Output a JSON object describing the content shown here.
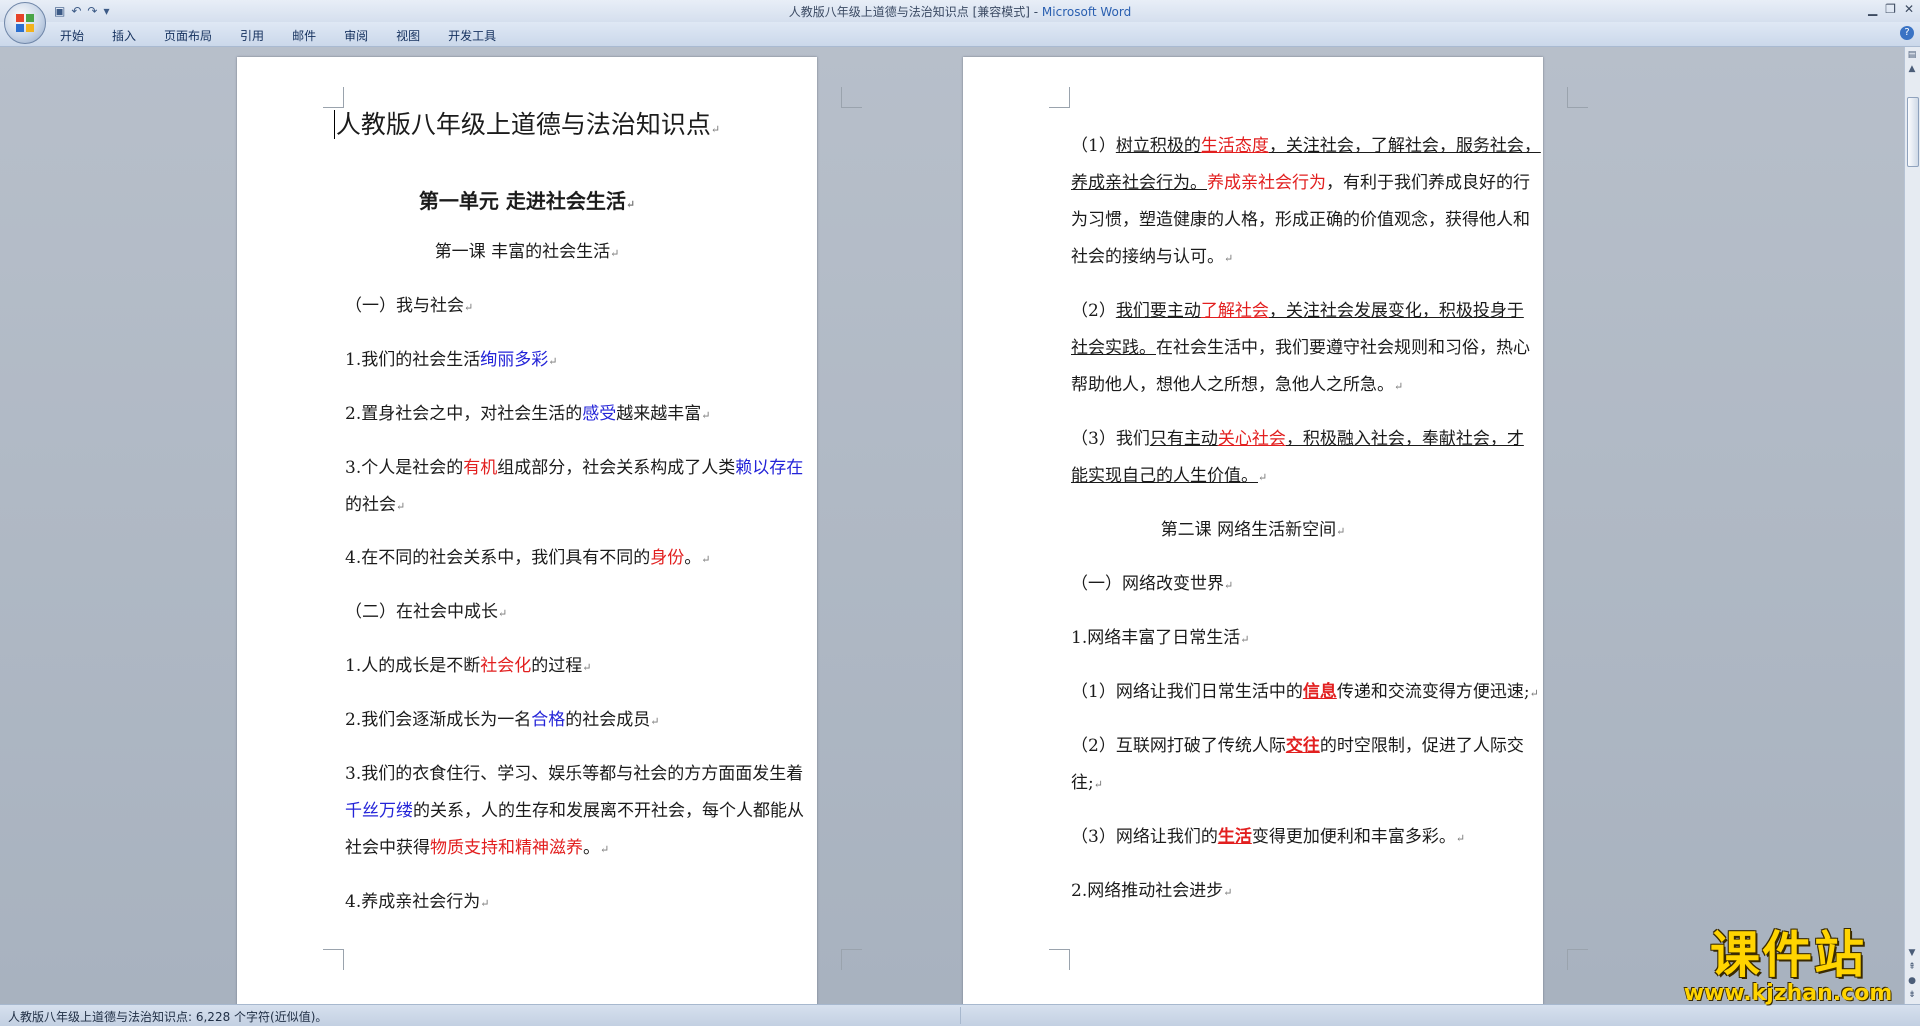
{
  "window": {
    "title": "人教版八年级上道德与法治知识点 [兼容模式] - ",
    "app": "Microsoft Word"
  },
  "ribbon": {
    "tabs": [
      "开始",
      "插入",
      "页面布局",
      "引用",
      "邮件",
      "审阅",
      "视图",
      "开发工具"
    ]
  },
  "left_page": {
    "title": "人教版八年级上道德与法治知识点",
    "unit": "第一单元 走进社会生活",
    "lesson": "第一课 丰富的社会生活",
    "sec1": "（一）我与社会",
    "p1a": "1.我们的社会生活",
    "p1b": "绚丽多彩",
    "p2a": "2.置身社会之中，对社会生活的",
    "p2b": "感受",
    "p2c": "越来越丰富",
    "p3a": "3.个人是社会的",
    "p3b": "有机",
    "p3c": "组成部分，社会关系构成了人类",
    "p3d": "赖以存在",
    "p3e": "的社会",
    "p4a": "4.在不同的社会关系中，我们具有不同的",
    "p4b": "身份",
    "p4c": "。",
    "sec2": "（二）在社会中成长",
    "q1a": "1.人的成长是不断",
    "q1b": "社会化",
    "q1c": "的过程",
    "q2a": "2.我们会逐渐成长为一名",
    "q2b": "合格",
    "q2c": "的社会成员",
    "q3a": "3.我们的衣食住行、学习、娱乐等都与社会的方方面面发生着",
    "q3b": "千丝万缕",
    "q3c": "的关系，人的生存和发展离不开社会，每个人都能从",
    "q3d": "社会中获得",
    "q3e": "物质支持和精神滋养",
    "q3f": "。",
    "q4": "4.养成亲社会行为"
  },
  "right_page": {
    "r1a": "（1）",
    "r1b": "树立积极的",
    "r1c": "生活态度",
    "r1d": "，关注社会，了解社会，服务社会，",
    "r1e": "养成亲社会行为。",
    "r1f": "养成亲社会行为",
    "r1g": "，有利于我们养成良好的行",
    "r1h": "为习惯，塑造健康的人格，形成正确的价值观念，获得他人和",
    "r1i": "社会的接纳与认可。",
    "r2a": "（2）",
    "r2b": "我们要主动",
    "r2c": "了解社会",
    "r2d": "，关注社会发展变化，积极投身于",
    "r2e": "社会实践。",
    "r2f": "在社会生活中，我们要遵守社会规则和习俗，热心",
    "r2g": "帮助他人，想他人之所想，急他人之所急。",
    "r3a": "（3）我们",
    "r3b": "只有主动",
    "r3c": "关心社会",
    "r3d": "，积极融入社会，奉献社会，才",
    "r3e": "能实现自己的人生价值。",
    "lesson2": "第二课 网络生活新空间",
    "sec": "（一）网络改变世界",
    "n1": "1.网络丰富了日常生活",
    "n1a": "（1）网络让我们日常生活中的",
    "n1b": "信息",
    "n1c": "传递和交流变得方便迅速;",
    "n2a": "（2）互联网打破了传统人际",
    "n2b": "交往",
    "n2c": "的时空限制，促进了人际交",
    "n2d": "往;",
    "n3a": "（3）网络让我们的",
    "n3b": "生活",
    "n3c": "变得更加便利和丰富多彩。",
    "n4": "2.网络推动社会进步"
  },
  "status": {
    "text": "人教版八年级上道德与法治知识点: 6,228 个字符(近似值)。"
  },
  "watermark": {
    "big": "课件站",
    "small": "www.kjzhan.com"
  },
  "para_mark": "↵"
}
